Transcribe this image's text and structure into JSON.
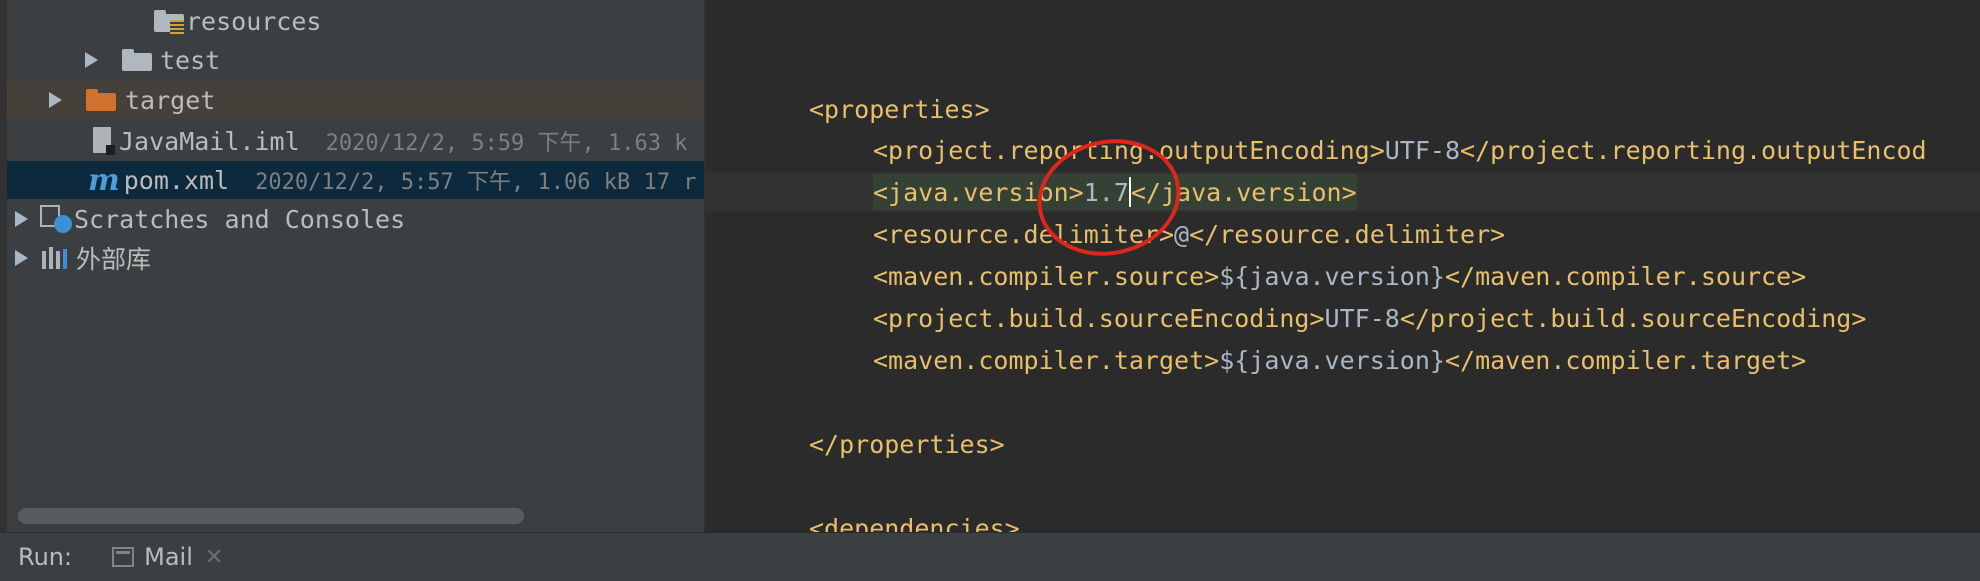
{
  "project_tree": {
    "items": [
      {
        "label": "resources",
        "icon": "resources-folder-icon"
      },
      {
        "label": "test",
        "icon": "folder-icon"
      },
      {
        "label": "target",
        "icon": "excluded-folder-icon"
      },
      {
        "label": "JavaMail.iml",
        "meta": "2020/12/2, 5:59 下午, 1.63 k",
        "icon": "iml-file-icon"
      },
      {
        "label": "pom.xml",
        "meta": "2020/12/2, 5:57 下午, 1.06 kB 17 r",
        "icon": "maven-file-icon"
      },
      {
        "label": "Scratches and Consoles",
        "icon": "scratches-icon"
      },
      {
        "label": "外部库",
        "icon": "libraries-icon"
      }
    ]
  },
  "editor": {
    "lines": {
      "props_open": "<properties>",
      "enc_open": "<project.reporting.outputEncoding>",
      "enc_val": "UTF-8",
      "enc_close": "</project.reporting.outputEncod",
      "jv_open": "<java.version>",
      "jv_val_a": "1.7",
      "jv_close": "</java.version>",
      "rd_open": "<resource.delimiter>",
      "rd_val": "@",
      "rd_close": "</resource.delimiter>",
      "mcs_open": "<maven.compiler.source>",
      "mcs_val": "${java.version}",
      "mcs_close": "</maven.compiler.source>",
      "pbs_open": "<project.build.sourceEncoding>",
      "pbs_val": "UTF-8",
      "pbs_close": "</project.build.sourceEncoding>",
      "mct_open": "<maven.compiler.target>",
      "mct_val": "${java.version}",
      "mct_close": "</maven.compiler.target>",
      "props_close": "</properties>",
      "deps_open": "<dependencies>"
    }
  },
  "run_bar": {
    "label": "Run:",
    "tab_label": "Mail",
    "tab_icon": "console-icon",
    "close_icon": "close-icon"
  },
  "colors": {
    "tag": "#e8bf6a",
    "text": "#a9b7c6",
    "annotation": "#e0261a",
    "selected_row": "#0d293e"
  }
}
